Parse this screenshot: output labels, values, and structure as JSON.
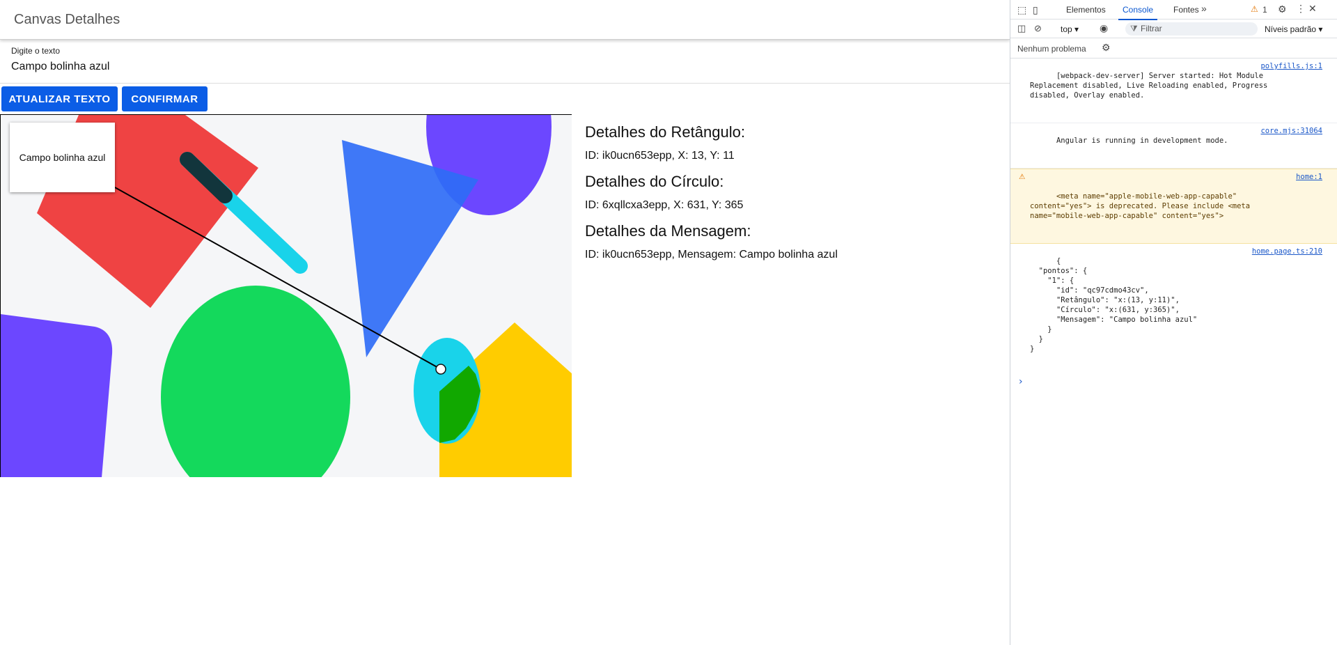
{
  "app": {
    "title": "Canvas Detalhes",
    "input": {
      "label": "Digite o texto",
      "value": "Campo bolinha azul"
    },
    "buttons": {
      "update": "ATUALIZAR TEXTO",
      "confirm": "CONFIRMAR"
    },
    "canvas": {
      "message_box": "Campo bolinha azul"
    },
    "details": {
      "rect_title": "Detalhes do Retângulo:",
      "rect_info": "ID: ik0ucn653epp, X: 13, Y: 11",
      "circle_title": "Detalhes do Círculo:",
      "circle_info": "ID: 6xqllcxa3epp, X: 631, Y: 365",
      "message_title": "Detalhes da Mensagem:",
      "message_info": "ID: ik0ucn653epp, Mensagem: Campo bolinha azul"
    }
  },
  "devtools": {
    "tabs": [
      "Elementos",
      "Console",
      "Fontes"
    ],
    "active_tab": "Console",
    "warning_count": "1",
    "context": "top",
    "filter_placeholder": "Filtrar",
    "levels": "Níveis padrão",
    "issues": "Nenhum problema",
    "console": [
      {
        "text": "[webpack-dev-server] Server started: Hot Module\nReplacement disabled, Live Reloading enabled, Progress\ndisabled, Overlay enabled.",
        "source": "polyfills.js:1"
      },
      {
        "text": "Angular is running in development mode.",
        "source": "core.mjs:31064"
      },
      {
        "text": "<meta name=\"apple-mobile-web-app-capable\"\ncontent=\"yes\"> is deprecated. Please include <meta\nname=\"mobile-web-app-capable\" content=\"yes\">",
        "source": "home:1"
      },
      {
        "text": "{\n  \"pontos\": {\n    \"1\": {\n      \"id\": \"qc97cdmo43cv\",\n      \"Retângulo\": \"x:(13, y:11)\",\n      \"Círculo\": \"x:(631, y:365)\",\n      \"Mensagem\": \"Campo bolinha azul\"\n    }\n  }\n}",
        "source": "home.page.ts:210"
      }
    ]
  },
  "colors": {
    "primary_button": "#0b5de6",
    "devtools_accent": "#0b57d0"
  }
}
